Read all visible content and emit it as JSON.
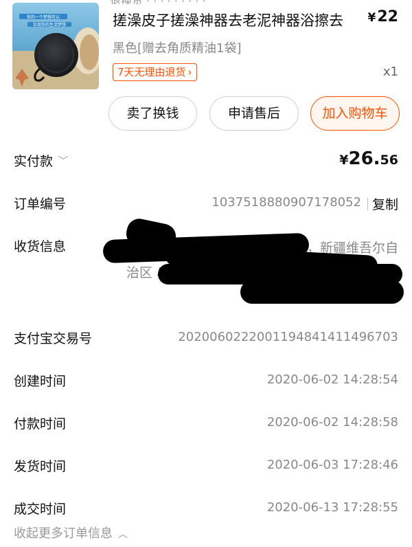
{
  "product": {
    "title": "搓澡皮子搓澡神器去老泥神器浴擦去",
    "price": "22",
    "currency": "¥",
    "spec": "黑色[赠去角质精油1袋]",
    "tag": "7天无理由退货",
    "quantity": "x1",
    "thumbnail_banner_1": "你的一个梦想可以",
    "thumbnail_banner_2": "实现你的生活梦想"
  },
  "actions": {
    "sell": "卖了换钱",
    "after_sale": "申请售后",
    "add_cart": "加入购物车"
  },
  "payment": {
    "label": "实付款",
    "currency": "¥",
    "amount_int": "26.",
    "amount_dec": "56"
  },
  "order": {
    "label": "订单编号",
    "number": "1037518880907178052",
    "copy": "复制"
  },
  "shipping": {
    "label": "收货信息",
    "line1": "99，新疆维吾尔自",
    "line2": "治区 乌"
  },
  "details": {
    "alipay_label": "支付宝交易号",
    "alipay_value": "2020060222001194841411496703",
    "created_label": "创建时间",
    "created_value": "2020-06-02 14:28:54",
    "paid_label": "付款时间",
    "paid_value": "2020-06-02 14:28:58",
    "shipped_label": "发货时间",
    "shipped_value": "2020-06-03 17:28:46",
    "deal_label": "成交时间",
    "deal_value": "2020-06-13 17:28:55"
  },
  "collapse": {
    "label": "收起更多订单信息"
  },
  "colors": {
    "accent": "#ff5000",
    "muted_text": "#888888",
    "primary_text": "#111111"
  }
}
